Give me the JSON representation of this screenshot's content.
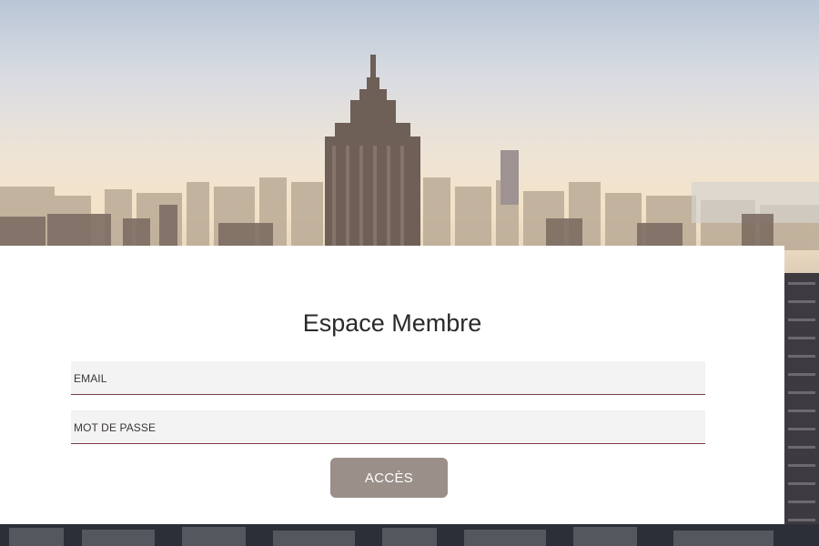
{
  "login": {
    "title": "Espace Membre",
    "email_label": "EMAIL",
    "password_label": "MOT DE PASSE",
    "submit_label": "ACCÈS"
  },
  "colors": {
    "button_bg": "#9a8f89",
    "field_bg": "#f4f3f3",
    "field_underline": "#7a3b45"
  },
  "icons": {
    "background": "city-skyline-photo"
  }
}
